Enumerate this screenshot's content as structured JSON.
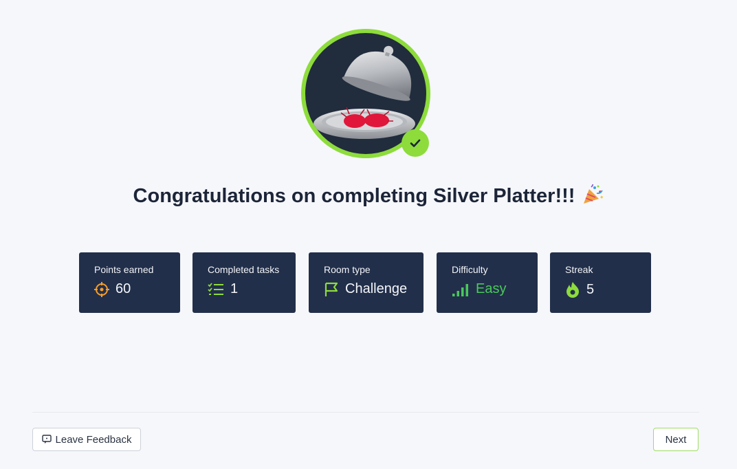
{
  "badge": {
    "icon": "silver-platter-room-icon",
    "check_icon": "check-icon",
    "ring_color": "#8ddc3c"
  },
  "header": {
    "title": "Congratulations on completing Silver Platter!!!",
    "emoji_icon": "party-popper-icon"
  },
  "stats": [
    {
      "label": "Points earned",
      "value": "60",
      "icon": "crosshair-icon",
      "icon_color": "#f59e2c"
    },
    {
      "label": "Completed tasks",
      "value": "1",
      "icon": "task-list-icon",
      "icon_color": "#8ddc3c"
    },
    {
      "label": "Room type",
      "value": "Challenge",
      "icon": "flag-icon",
      "icon_color": "#8ddc3c"
    },
    {
      "label": "Difficulty",
      "value": "Easy",
      "icon": "signal-bars-icon",
      "icon_color": "#49c95a"
    },
    {
      "label": "Streak",
      "value": "5",
      "icon": "flame-icon",
      "icon_color": "#8ddc3c"
    }
  ],
  "footer": {
    "feedback_label": "Leave Feedback",
    "feedback_icon": "message-icon",
    "next_label": "Next"
  }
}
